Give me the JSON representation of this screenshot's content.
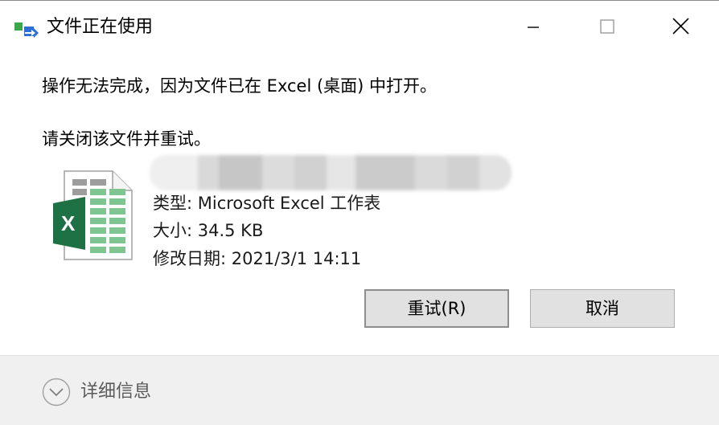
{
  "window": {
    "title": "文件正在使用"
  },
  "message": {
    "line1": "操作无法完成，因为文件已在 Excel (桌面) 中打开。",
    "line2": "请关闭该文件并重试。"
  },
  "file": {
    "icon": "excel-file-icon",
    "type_label": "类型: Microsoft Excel 工作表",
    "size_label": "大小: 34.5 KB",
    "date_label": "修改日期: 2021/3/1 14:11"
  },
  "buttons": {
    "retry": "重试(R)",
    "cancel": "取消"
  },
  "footer": {
    "details_label": "详细信息"
  },
  "colors": {
    "excel_green": "#1e7145",
    "excel_light_green": "#a9d18e",
    "button_bg": "#e1e1e1",
    "footer_bg": "#f0f0f0"
  }
}
